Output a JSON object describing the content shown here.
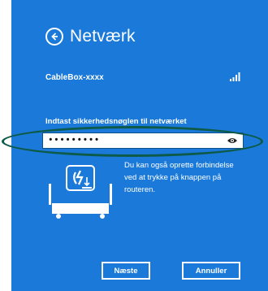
{
  "header": {
    "title": "Netværk",
    "back_icon": "back-arrow-circle-icon"
  },
  "network": {
    "name": "CableBox-xxxx",
    "signal_icon": "signal-strength-icon"
  },
  "security_key": {
    "prompt": "Indtast sikkerhedsnøglen til netværket",
    "value": "•••••••••",
    "reveal_icon": "eye-icon"
  },
  "wps": {
    "icon": "router-wps-icon",
    "text": "Du kan også oprette forbindelse ved at trykke på knappen på routeren."
  },
  "buttons": {
    "next_label": "Næste",
    "cancel_label": "Annuller"
  },
  "colors": {
    "panel_background": "#1a79d9",
    "highlight_ring": "#0e5a48",
    "text": "#ffffff"
  }
}
